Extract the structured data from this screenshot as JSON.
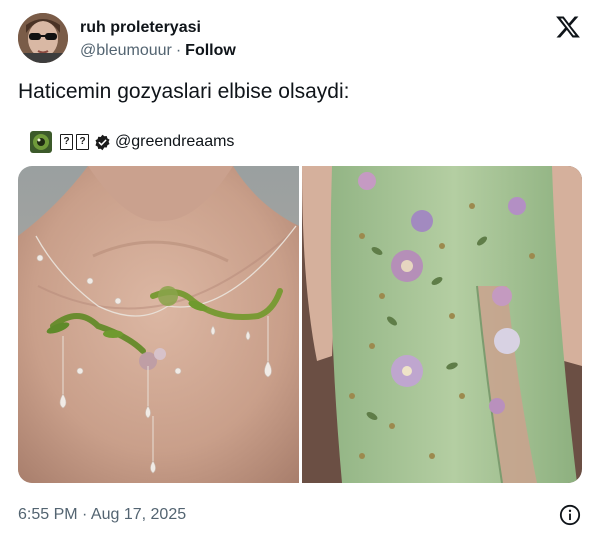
{
  "author": {
    "name": "ruh proleteryasi",
    "handle": "@bleumouur",
    "separator": "·",
    "follow_label": "Follow"
  },
  "tweet": {
    "text": "Haticemin gozyaslari elbise olsaydi:"
  },
  "quote": {
    "boxes": [
      "?",
      "?"
    ],
    "handle": "@greendreaams"
  },
  "media": [
    {
      "icon": "necklace-photo"
    },
    {
      "icon": "green-floral-dress-photo"
    }
  ],
  "footer": {
    "timestamp": "6:55 PM · Aug 17, 2025"
  },
  "colors": {
    "text": "#0f1419",
    "secondary": "#536471",
    "skin": "#c89b86",
    "dress_green": "#a9c79a"
  }
}
